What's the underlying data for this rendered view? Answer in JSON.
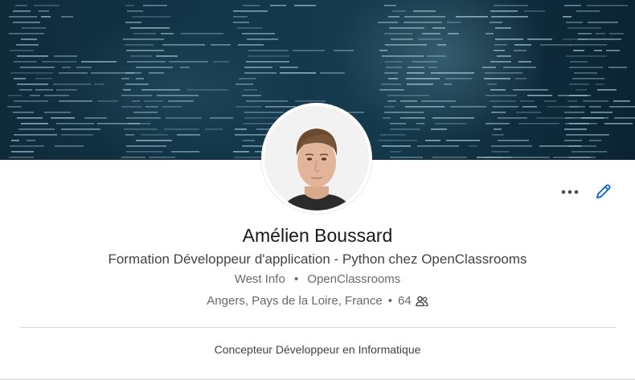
{
  "profile": {
    "name": "Amélien Boussard",
    "headline": "Formation Développeur d'application - Python chez OpenClassrooms",
    "company_1": "West Info",
    "separator": "•",
    "company_2": "OpenClassrooms",
    "location": "Angers, Pays de la Loire, France",
    "connections": "64",
    "summary": "Concepteur Développeur en Informatique"
  },
  "icons": {
    "more": "more-horizontal-icon",
    "edit": "pencil-icon",
    "connections": "people-icon"
  },
  "colors": {
    "banner": "#123447",
    "edit_icon": "#0a66c2",
    "text_primary": "#1a1a1a",
    "text_secondary": "#666666"
  }
}
